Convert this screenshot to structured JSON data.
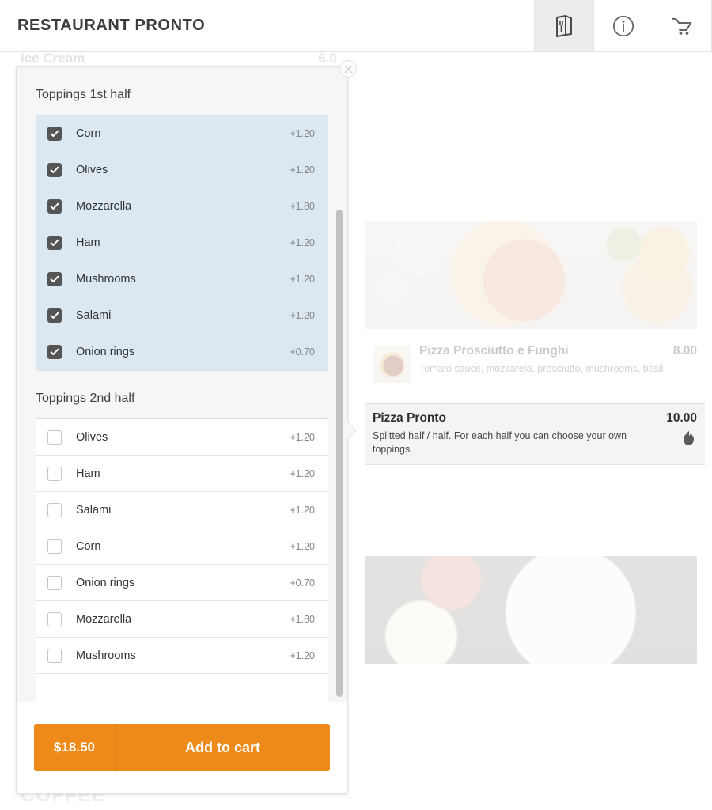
{
  "header": {
    "brand": "RESTAURANT PRONTO",
    "actions": [
      {
        "name": "menu-icon",
        "label": "Menu",
        "active": true
      },
      {
        "name": "info-icon",
        "label": "Info",
        "active": false
      },
      {
        "name": "cart-icon",
        "label": "Cart",
        "active": false
      }
    ]
  },
  "background": {
    "obscured_item": {
      "title": "Ice Cream",
      "price": "6.0"
    },
    "section_heading": "COFFEE",
    "items": [
      {
        "title": "Pizza Prosciutto e Funghi",
        "price": "8.00",
        "description": "Tomato sauce, mozzarela, prosciutto, mushrooms, basil",
        "has_thumb": true,
        "highlighted": false,
        "spicy": false
      },
      {
        "title": "Pizza Pronto",
        "price": "10.00",
        "description": "Splitted half / half. For each half you can choose your own toppings",
        "has_thumb": false,
        "highlighted": true,
        "spicy": true
      }
    ]
  },
  "modal": {
    "close_label": "×",
    "groups": [
      {
        "title": "Toppings 1st half",
        "options": [
          {
            "label": "Corn",
            "price": "+1.20",
            "checked": true
          },
          {
            "label": "Olives",
            "price": "+1.20",
            "checked": true
          },
          {
            "label": "Mozzarella",
            "price": "+1.80",
            "checked": true
          },
          {
            "label": "Ham",
            "price": "+1.20",
            "checked": true
          },
          {
            "label": "Mushrooms",
            "price": "+1.20",
            "checked": true
          },
          {
            "label": "Salami",
            "price": "+1.20",
            "checked": true
          },
          {
            "label": "Onion rings",
            "price": "+0.70",
            "checked": true
          }
        ]
      },
      {
        "title": "Toppings 2nd half",
        "options": [
          {
            "label": "Olives",
            "price": "+1.20",
            "checked": false
          },
          {
            "label": "Ham",
            "price": "+1.20",
            "checked": false
          },
          {
            "label": "Salami",
            "price": "+1.20",
            "checked": false
          },
          {
            "label": "Corn",
            "price": "+1.20",
            "checked": false
          },
          {
            "label": "Onion rings",
            "price": "+0.70",
            "checked": false
          },
          {
            "label": "Mozzarella",
            "price": "+1.80",
            "checked": false
          },
          {
            "label": "Mushrooms",
            "price": "+1.20",
            "checked": false
          },
          {
            "label": "",
            "price": "",
            "checked": false
          }
        ]
      }
    ],
    "footer": {
      "total": "$18.50",
      "add_to_cart": "Add to cart"
    }
  },
  "colors": {
    "accent": "#ee8a1a",
    "checked_row": "#dbe8f2",
    "checkbox": "#555555",
    "modal_bg": "#f6f6f6"
  }
}
